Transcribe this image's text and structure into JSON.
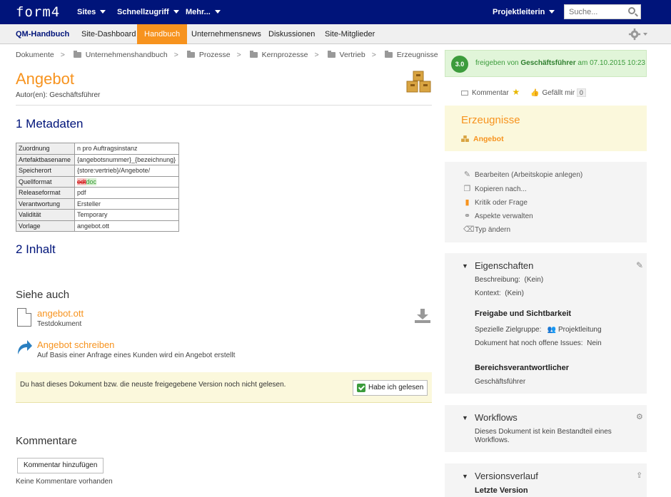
{
  "app": {
    "logo": "form4"
  },
  "topnav": {
    "sites": "Sites",
    "quick": "Schnellzugriff",
    "more": "Mehr...",
    "user": "Projektleiterin",
    "search_placeholder": "Suche..."
  },
  "tabs": {
    "site": "QM-Handbuch",
    "dashboard": "Site-Dashboard",
    "handbuch": "Handbuch",
    "news": "Unternehmensnews",
    "discussions": "Diskussionen",
    "members": "Site-Mitglieder"
  },
  "breadcrumb": [
    "Dokumente",
    "Unternehmenshandbuch",
    "Prozesse",
    "Kernprozesse",
    "Vertrieb",
    "Erzeugnisse"
  ],
  "doc": {
    "title": "Angebot",
    "author": "Autor(en): Geschäftsführer",
    "section1": "1 Metadaten",
    "section2": "2 Inhalt"
  },
  "metadata": [
    {
      "k": "Zuordnung",
      "v": "n pro Auftragsinstanz"
    },
    {
      "k": "Artefaktbasename",
      "v": "{angebotsnummer}_{bezeichnung}"
    },
    {
      "k": "Speicherort",
      "v": "{store:vertrieb}/Angebote/"
    },
    {
      "k": "Quellformat",
      "del": "odt",
      "ins": "doc"
    },
    {
      "k": "Releaseformat",
      "v": "pdf"
    },
    {
      "k": "Verantwortung",
      "v": "Ersteller"
    },
    {
      "k": "Validität",
      "v": "Temporary"
    },
    {
      "k": "Vorlage",
      "v": "angebot.ott"
    }
  ],
  "see_also": {
    "title": "Siehe auch",
    "file_name": "angebot.ott",
    "file_type": "Testdokument",
    "process_name": "Angebot schreiben",
    "process_desc": "Auf Basis einer Anfrage eines Kunden wird ein Angebot erstellt"
  },
  "notice": {
    "text": "Du hast dieses Dokument bzw. die neuste freigegebene Version noch nicht gelesen.",
    "button": "Habe ich gelesen"
  },
  "comments": {
    "title": "Kommentare",
    "add": "Kommentar hinzufügen",
    "none": "Keine Kommentare vorhanden"
  },
  "status": {
    "version": "3.0",
    "prefix": "freigeben von",
    "by": "Geschäftsführer",
    "on": "am 07.10.2015 10:23"
  },
  "social": {
    "comment": "Kommentar",
    "like": "Gefällt mir",
    "like_count": "0"
  },
  "erzeugnisse": {
    "title": "Erzeugnisse",
    "item": "Angebot"
  },
  "actions": [
    "Bearbeiten (Arbeitskopie anlegen)",
    "Kopieren nach...",
    "Kritik oder Frage",
    "Aspekte verwalten",
    "Typ ändern"
  ],
  "properties": {
    "title": "Eigenschaften",
    "beschreibung_label": "Beschreibung:",
    "beschreibung_value": "(Kein)",
    "kontext_label": "Kontext:",
    "kontext_value": "(Kein)",
    "release_title": "Freigabe und Sichtbarkeit",
    "zielgruppe_label": "Spezielle Zielgruppe:",
    "zielgruppe_value": "Projektleitung",
    "issues_label": "Dokument hat noch offene Issues:",
    "issues_value": "Nein",
    "verantw_title": "Bereichsverantwortlicher",
    "verantw_value": "Geschäftsführer"
  },
  "workflows": {
    "title": "Workflows",
    "text1": "Dieses Dokument ist kein Bestandteil eines",
    "text2": "Workflows."
  },
  "versions": {
    "title": "Versionsverlauf",
    "latest": "Letzte Version"
  },
  "colors": {
    "navy": "#00147a",
    "orange": "#f7931e",
    "green": "#3c9c3c"
  }
}
